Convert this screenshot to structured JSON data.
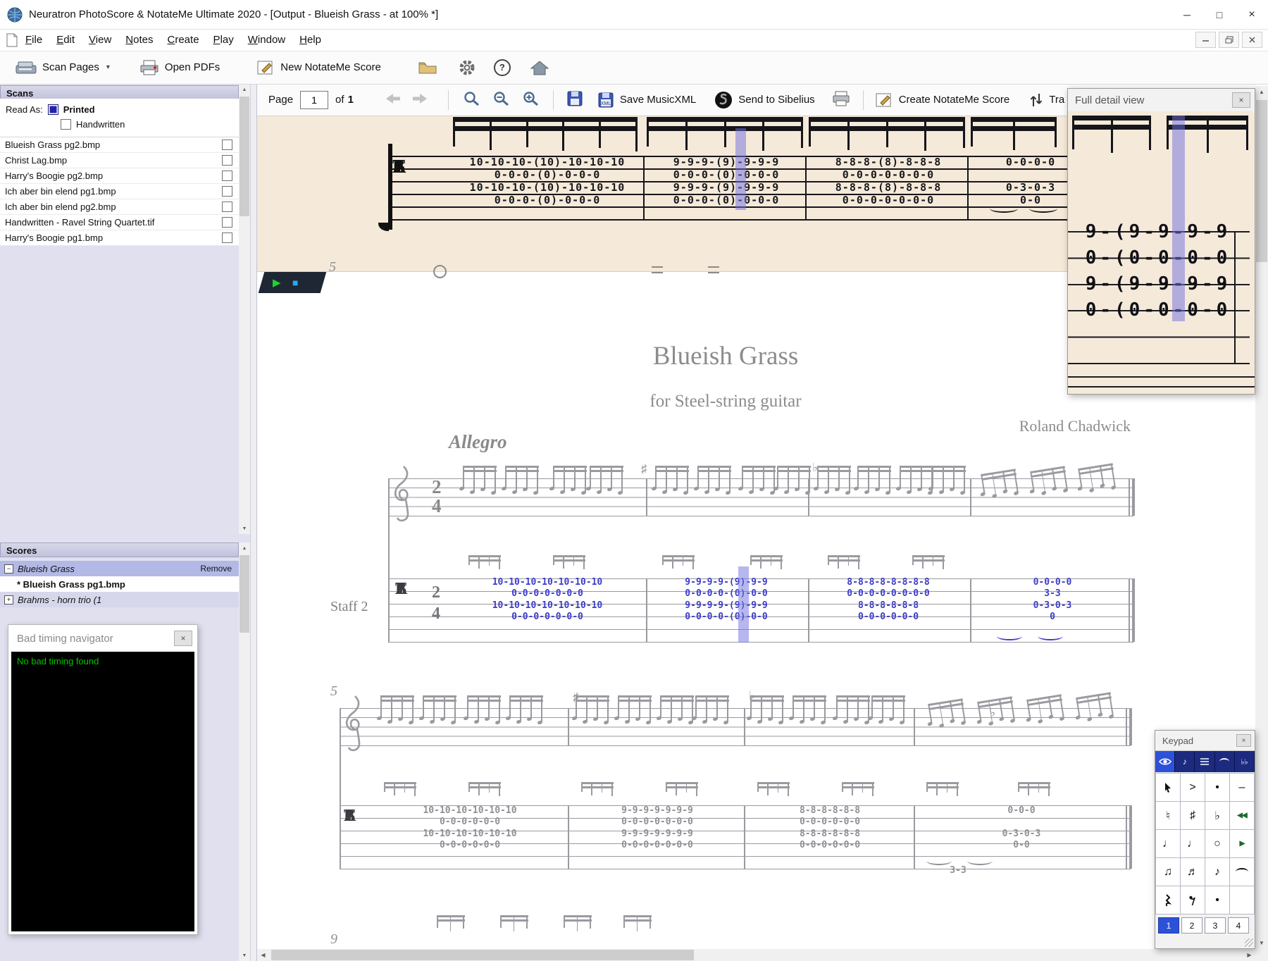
{
  "window": {
    "title": "Neuratron PhotoScore & NotateMe Ultimate 2020 - [Output - Blueish Grass - at 100% *]"
  },
  "menu": {
    "items": [
      "File",
      "Edit",
      "View",
      "Notes",
      "Create",
      "Play",
      "Window",
      "Help"
    ]
  },
  "toolbar": {
    "scan_pages": "Scan Pages",
    "open_pdfs": "Open PDFs",
    "new_notateme": "New NotateMe Score"
  },
  "pagebar": {
    "page_label": "Page",
    "page_value": "1",
    "of_label": "of",
    "page_total": "1",
    "save_musicxml": "Save MusicXML",
    "send_to_sibelius": "Send to Sibelius",
    "create_notateme": "Create NotateMe Score",
    "transpose": "Tra"
  },
  "scans": {
    "header": "Scans",
    "read_as": "Read As:",
    "printed": "Printed",
    "handwritten": "Handwritten",
    "files": [
      "Blueish Grass pg2.bmp",
      "Christ Lag.bmp",
      "Harry's Boogie pg2.bmp",
      "Ich aber bin elend pg1.bmp",
      "Ich aber bin elend pg2.bmp",
      "Handwritten - Ravel String Quartet.tif",
      "Harry's Boogie pg1.bmp"
    ]
  },
  "scores": {
    "header": "Scores",
    "items": [
      {
        "label": "Blueish Grass",
        "action": "Remove"
      },
      {
        "label": "* Blueish Grass pg1.bmp"
      },
      {
        "label": "Brahms - horn trio (1"
      }
    ]
  },
  "bad_timing": {
    "title": "Bad timing navigator",
    "message": "No bad timing found"
  },
  "full_detail": {
    "title": "Full detail view",
    "rows": [
      "9-(9-9-9-9",
      "0-(0-0-0-0",
      "9-(9-9-9-9",
      "0-(0-0-0-0"
    ]
  },
  "score": {
    "title": "Blueish Grass",
    "subtitle": "for Steel-string guitar",
    "composer": "Roland Chadwick",
    "tempo": "Allegro",
    "staff_label": "Staff 2",
    "tab_clef": [
      "T",
      "A",
      "B"
    ],
    "time_sig": {
      "top": "2",
      "bottom": "4"
    },
    "system_numbers": {
      "second": "5",
      "third": "9"
    },
    "scan_edge_number": "5"
  },
  "tabs": {
    "scan": {
      "measures": [
        [
          "10-10-10-(10)-10-10-10",
          "0-0-0-(0)-0-0-0",
          "10-10-10-(10)-10-10-10",
          "0-0-0-(0)-0-0-0"
        ],
        [
          "9-9-9-(9)-9-9-9",
          "0-0-0-(0)-0-0-0",
          "9-9-9-(9)-9-9-9",
          "0-0-0-(0)-0-0-0"
        ],
        [
          "8-8-8-(8)-8-8-8",
          "0-0-0-0-0-0-0",
          "8-8-8-(8)-8-8-8",
          "0-0-0-0-0-0-0"
        ],
        [
          "0-0-0-0",
          "",
          "0-3-0-3",
          "0-0"
        ]
      ]
    },
    "system1": {
      "measures": [
        [
          "10-10-10-10-10-10-10",
          "0-0-0-0-0-0-0",
          "10-10-10-10-10-10-10",
          "0-0-0-0-0-0-0"
        ],
        [
          "9-9-9-9-(9)-9-9",
          "0-0-0-0-(0)-0-0",
          "9-9-9-9-(9)-9-9",
          "0-0-0-0-(0)-0-0"
        ],
        [
          "8-8-8-8-8-8-8-8",
          "0-0-0-0-0-0-0-0",
          "8-8-8-8-8-8",
          "0-0-0-0-0-0"
        ],
        [
          "0-0-0-0",
          "3-3",
          "0-3-0-3",
          "0"
        ]
      ]
    },
    "system2": {
      "measures": [
        [
          "10-10-10-10-10-10",
          "0-0-0-0-0-0",
          "10-10-10-10-10-10",
          "0-0-0-0-0-0"
        ],
        [
          "9-9-9-9-9-9-9",
          "0-0-0-0-0-0-0",
          "9-9-9-9-9-9-9",
          "0-0-0-0-0-0-0"
        ],
        [
          "8-8-8-8-8-8",
          "0-0-0-0-0-0",
          "8-8-8-8-8-8",
          "0-0-0-0-0-0"
        ],
        [
          "0-0-0",
          "",
          "0-3-0-3",
          "0-0"
        ]
      ],
      "below": "3-3"
    }
  },
  "keypad": {
    "title": "Keypad",
    "toggles": [
      "view",
      "note",
      "bars",
      "slur",
      "double-flat"
    ],
    "grid": [
      [
        {
          "n": "cursor"
        },
        {
          "g": ">",
          "n": "accent"
        },
        {
          "g": "•",
          "n": "staccato"
        },
        {
          "g": "–",
          "n": "tenuto"
        }
      ],
      [
        {
          "g": "♮",
          "n": "natural"
        },
        {
          "g": "♯",
          "n": "sharp"
        },
        {
          "g": "♭",
          "n": "flat"
        },
        {
          "g": "◀◀",
          "n": "rewind",
          "c": "green"
        }
      ],
      [
        {
          "g": "♩",
          "n": "quarter-note"
        },
        {
          "g": "♩",
          "n": "half-note"
        },
        {
          "g": "○",
          "n": "whole-note"
        },
        {
          "g": "▶",
          "n": "play",
          "c": "green"
        }
      ],
      [
        {
          "g": "♫",
          "n": "beamed-eighths"
        },
        {
          "g": "♬",
          "n": "beamed-sixteenths"
        },
        {
          "g": "♪",
          "n": "eighth-note"
        },
        {
          "n": "tie"
        }
      ],
      [
        {
          "n": "quarter-rest"
        },
        {
          "n": "eighth-rest"
        },
        {
          "g": "•",
          "n": "dot"
        },
        {
          "g": "",
          "n": "blank"
        }
      ]
    ],
    "tabs": [
      "1",
      "2",
      "3",
      "4"
    ]
  },
  "colors": {
    "beige": "#f5e9d9",
    "tab_blue": "#3c3cc8",
    "score_gray": "#9a9aa0",
    "highlight": "#7070e0",
    "timing_green": "#00c400",
    "keypad_blue": "#2d52d8"
  }
}
